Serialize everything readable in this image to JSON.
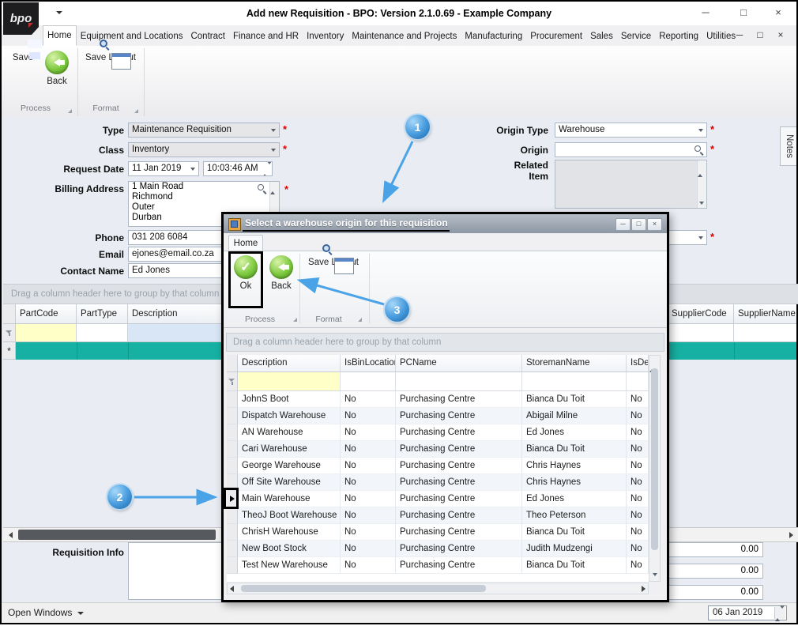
{
  "window": {
    "title": "Add new Requisition - BPO: Version 2.1.0.69 - Example Company",
    "logo_text": "bpo"
  },
  "icons": {
    "minimize": "─",
    "maximize": "□",
    "close": "×",
    "check": "✓",
    "required_marker": "*"
  },
  "ribbon": {
    "tabs": [
      "Home",
      "Equipment and Locations",
      "Contract",
      "Finance and HR",
      "Inventory",
      "Maintenance and Projects",
      "Manufacturing",
      "Procurement",
      "Sales",
      "Service",
      "Reporting",
      "Utilities"
    ],
    "active_tab": "Home",
    "buttons": {
      "save": "Save",
      "back": "Back",
      "save_layout": "Save Layout"
    },
    "groups": {
      "process": "Process",
      "format": "Format"
    }
  },
  "form": {
    "type": {
      "label": "Type",
      "value": "Maintenance Requisition"
    },
    "class": {
      "label": "Class",
      "value": "Inventory"
    },
    "request_date": {
      "label": "Request Date",
      "date": "11 Jan 2019",
      "time": "10:03:46 AM"
    },
    "billing_address": {
      "label": "Billing Address",
      "lines": [
        "1 Main Road",
        "Richmond",
        "Outer",
        "Durban"
      ]
    },
    "phone": {
      "label": "Phone",
      "value": "031 208 6084"
    },
    "email": {
      "label": "Email",
      "value": "ejones@email.co.za"
    },
    "contact_name": {
      "label": "Contact Name",
      "value": "Ed Jones"
    },
    "origin_type": {
      "label": "Origin Type",
      "value": "Warehouse"
    },
    "origin": {
      "label": "Origin",
      "value": ""
    },
    "related_item": {
      "label": "Related Item"
    }
  },
  "notes_label": "Notes",
  "main_grid": {
    "group_hint": "Drag a column header here to group by that column",
    "columns": [
      "PartCode",
      "PartType",
      "Description",
      "SupplierCode",
      "SupplierName"
    ],
    "new_row_marker": "*"
  },
  "dialog": {
    "title": "Select a warehouse origin for this requisition",
    "tab_home": "Home",
    "buttons": {
      "ok": "Ok",
      "back": "Back",
      "save_layout": "Save Layout"
    },
    "groups": {
      "process": "Process",
      "format": "Format"
    },
    "group_hint": "Drag a column header here to group by that column",
    "grid": {
      "columns": [
        "Description",
        "IsBinLocation",
        "PCName",
        "StoremanName",
        "IsDefau"
      ],
      "rows": [
        [
          "JohnS Boot",
          "No",
          "Purchasing Centre",
          "Bianca Du Toit",
          "No"
        ],
        [
          "Dispatch Warehouse",
          "No",
          "Purchasing Centre",
          "Abigail Milne",
          "No"
        ],
        [
          "AN Warehouse",
          "No",
          "Purchasing Centre",
          "Ed Jones",
          "No"
        ],
        [
          "Cari Warehouse",
          "No",
          "Purchasing Centre",
          "Bianca Du Toit",
          "No"
        ],
        [
          "George Warehouse",
          "No",
          "Purchasing Centre",
          "Chris Haynes",
          "No"
        ],
        [
          "Off Site Warehouse",
          "No",
          "Purchasing Centre",
          "Chris Haynes",
          "No"
        ],
        [
          "Main Warehouse",
          "No",
          "Purchasing Centre",
          "Ed Jones",
          "No"
        ],
        [
          "TheoJ Boot Warehouse",
          "No",
          "Purchasing Centre",
          "Theo Peterson",
          "No"
        ],
        [
          "ChrisH Warehouse",
          "No",
          "Purchasing Centre",
          "Bianca Du Toit",
          "No"
        ],
        [
          "New Boot Stock",
          "No",
          "Purchasing Centre",
          "Judith Mudzengi",
          "No"
        ],
        [
          "Test New Warehouse",
          "No",
          "Purchasing Centre",
          "Bianca Du Toit",
          "No"
        ]
      ],
      "selected_row": "Main Warehouse",
      "selected_row_index": 6
    }
  },
  "callouts": {
    "c1": "1",
    "c2": "2",
    "c3": "3"
  },
  "footer": {
    "requisition_info_label": "Requisition Info",
    "totals": [
      "0.00",
      "0.00",
      "0.00"
    ]
  },
  "statusbar": {
    "open_windows_label": "Open Windows",
    "date_value": "06 Jan 2019"
  },
  "colors": {
    "new_row_teal": "#17b1a3",
    "callout_blue": "#4aa3e6",
    "required_red": "#e00000"
  }
}
